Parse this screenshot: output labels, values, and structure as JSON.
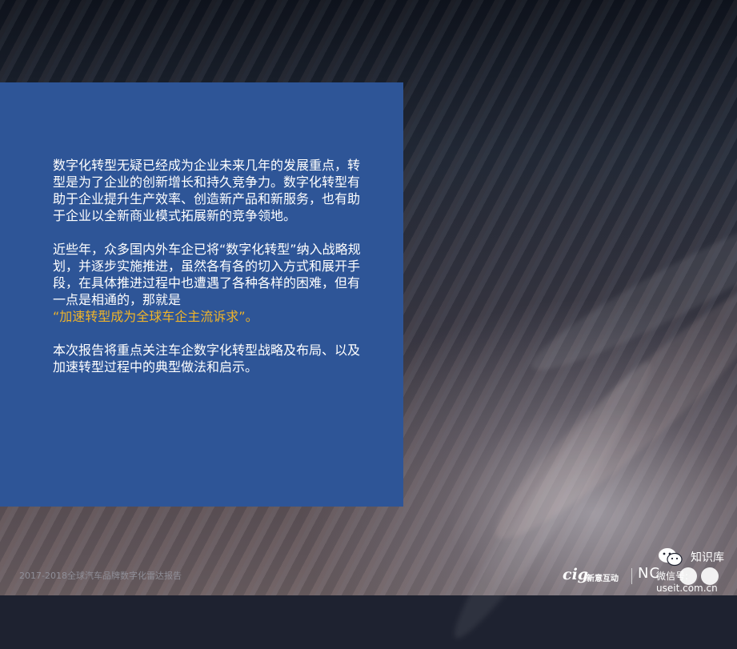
{
  "body": {
    "para1": "数字化转型无疑已经成为企业未来几年的发展重点，转型是为了企业的创新增长和持久竞争力。数字化转型有助于企业提升生产效率、创造新产品和新服务，也有助于企业以全新商业模式拓展新的竞争领地。",
    "para2": "近些年，众多国内外车企已将“数字化转型”纳入战略规划，并逐步实施推进，虽然各有各的切入方式和展开手段，在具体推进过程中也遭遇了各种各样的困难，但有一点是相通的，那就是",
    "para2_highlight": "“加速转型成为全球车企主流诉求”。",
    "para3": "本次报告将重点关注车企数字化转型战略及布局、以及加速转型过程中的典型做法和启示。"
  },
  "footer": {
    "report_title": "2017-2018全球汽车品牌数字化雷达报告"
  },
  "logos": {
    "cig": "cig",
    "cig_name": "新意互动",
    "nc": "NC"
  },
  "watermark": {
    "account": "知识库",
    "site": "微信号: useit.com.cn"
  },
  "colors": {
    "panel": "#2e5597",
    "highlight": "#f0b429"
  }
}
